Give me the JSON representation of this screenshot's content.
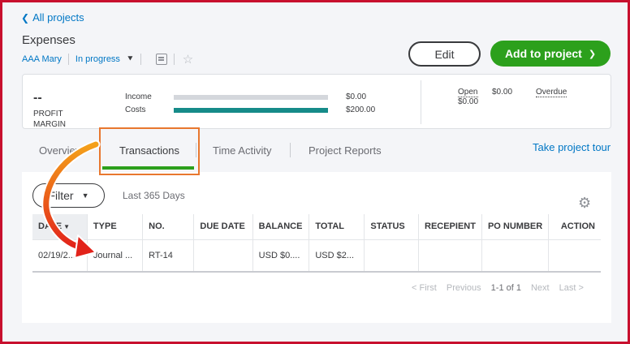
{
  "nav": {
    "back_label": "All projects"
  },
  "project": {
    "title": "Expenses",
    "customer": "AAA Mary",
    "status": "In progress"
  },
  "buttons": {
    "edit": "Edit",
    "add_to_project": "Add to project"
  },
  "summary": {
    "profit_margin_value": "--",
    "profit_margin_label": "PROFIT MARGIN",
    "income_label": "Income",
    "income_amount": "$0.00",
    "income_color": "#d4d7dc",
    "costs_label": "Costs",
    "costs_amount": "$200.00",
    "costs_color": "#168b89",
    "open_label": "Open",
    "open_amount": "$0.00",
    "open_sub_amount": "$0.00",
    "overdue_label": "Overdue"
  },
  "tabs": [
    "Overview",
    "Transactions",
    "Time Activity",
    "Project Reports"
  ],
  "active_tab": "Transactions",
  "tour_link": "Take project tour",
  "filter": {
    "label": "Filter",
    "range": "Last 365 Days"
  },
  "table": {
    "columns": [
      "DATE",
      "TYPE",
      "NO.",
      "DUE DATE",
      "BALANCE",
      "TOTAL",
      "STATUS",
      "RECEPIENT",
      "PO NUMBER",
      "ACTION"
    ],
    "rows": [
      [
        "02/19/2...",
        "Journal ...",
        "RT-14",
        "",
        "USD $0....",
        "USD $2...",
        "",
        "",
        "",
        ""
      ]
    ]
  },
  "pager": {
    "first": "< First",
    "previous": "Previous",
    "count": "1-1 of 1",
    "next": "Next",
    "last": "Last >"
  },
  "colors": {
    "accent": "#2ca01c",
    "link": "#0077c5",
    "annotation": "#e8772e",
    "frame": "#c8102e"
  }
}
